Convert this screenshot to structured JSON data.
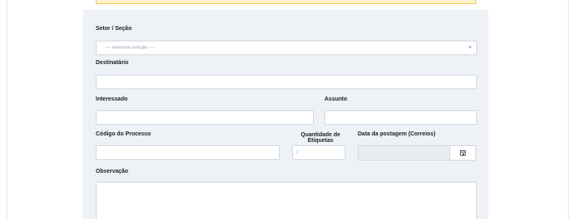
{
  "form": {
    "setor": {
      "label": "Setor / Seção",
      "placeholder": "---- selecione seleção ----"
    },
    "destinatario": {
      "label": "Destinatário",
      "value": ""
    },
    "interessado": {
      "label": "Interessado",
      "value": ""
    },
    "assunto": {
      "label": "Assunto",
      "value": ""
    },
    "codigo_processo": {
      "label": "Código do Processo",
      "value": ""
    },
    "quantidade_etiquetas": {
      "label_line1": "Quantidade de",
      "label_line2": "Etiquetas",
      "value": "2"
    },
    "data_postagem": {
      "label": "Data da postagem (Correios)",
      "value": "",
      "button_icon": "calendar-icon"
    },
    "observacao": {
      "label": "Observação",
      "value": ""
    }
  },
  "colors": {
    "panel_background": "#eef1f5",
    "alert_background": "#fff3cd",
    "alert_border": "#f2c94c",
    "field_border": "#cfd8e3"
  }
}
